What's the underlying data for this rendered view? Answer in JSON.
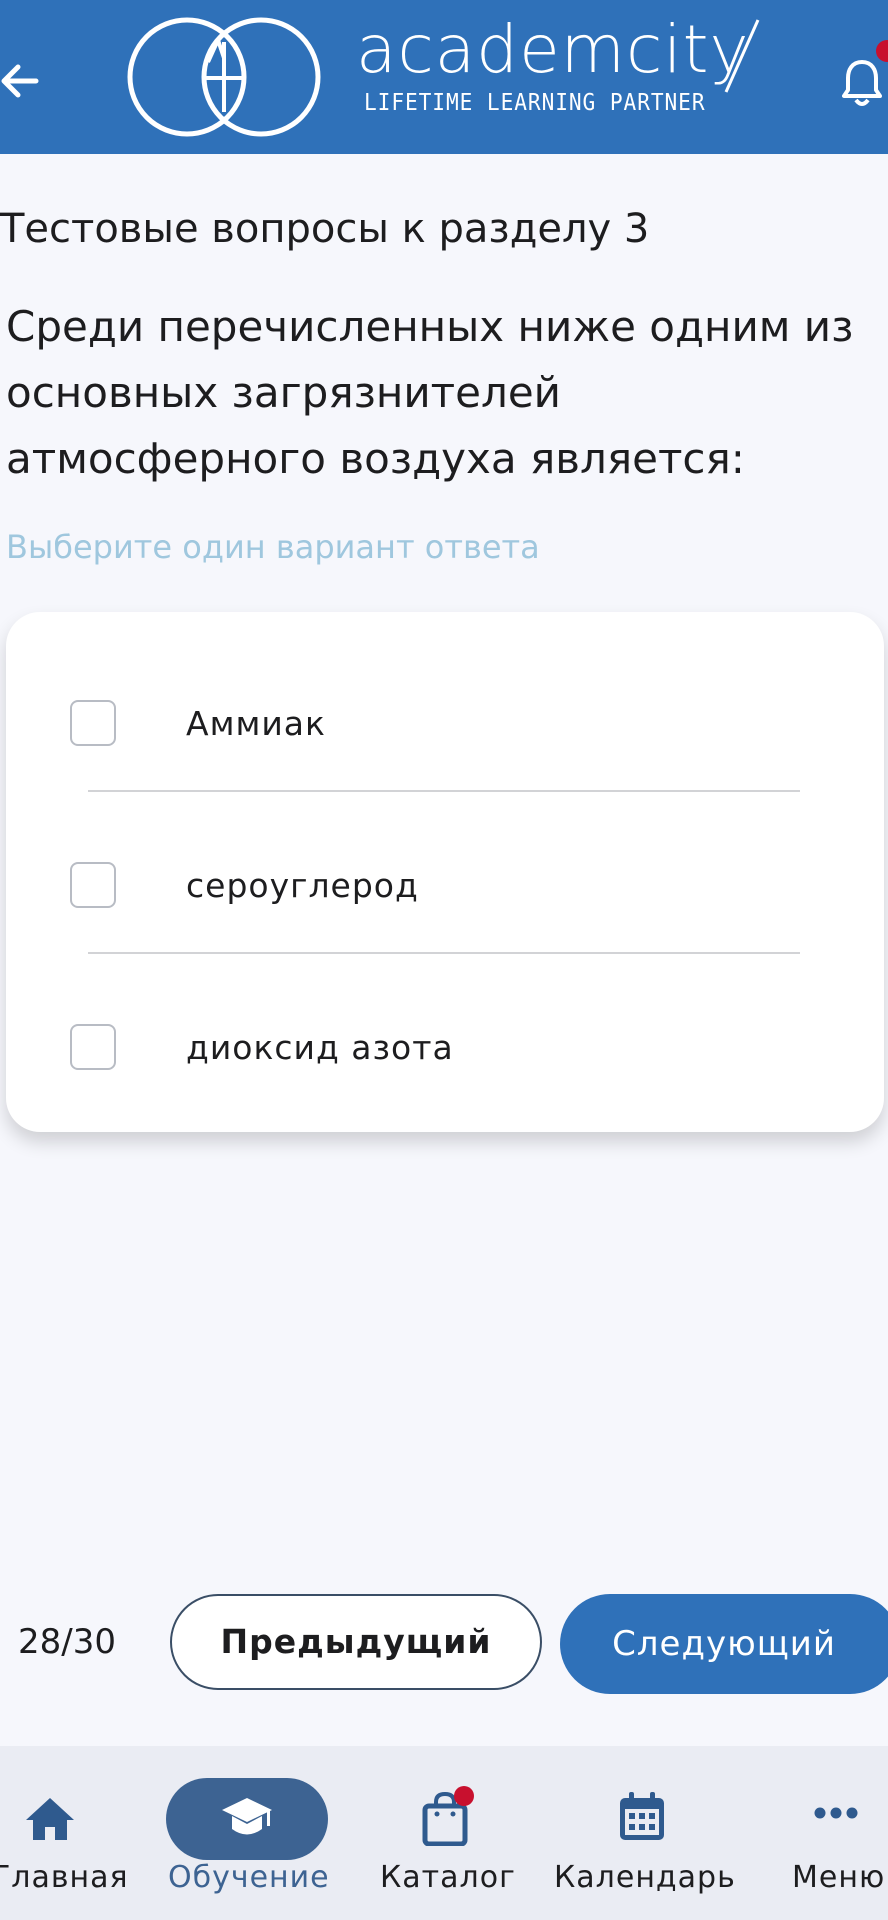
{
  "header": {
    "brand_name": "academcity",
    "brand_tagline": "LIFETIME LEARNING PARTNER"
  },
  "quiz": {
    "section_title": "Тестовые вопросы к разделу 3",
    "question": "Среди перечисленных ниже одним из основных загрязнителей атмосферного воздуха является:",
    "hint": "Выберите один вариант ответа",
    "options": [
      {
        "label": "Аммиак",
        "checked": false
      },
      {
        "label": "сероуглерод",
        "checked": false
      },
      {
        "label": "диоксид азота",
        "checked": false
      }
    ]
  },
  "pager": {
    "counter": "28/30",
    "prev_label": "Предыдущий",
    "next_label": "Следующий"
  },
  "bottom_nav": {
    "items": [
      {
        "label": "Главная",
        "icon": "home-icon"
      },
      {
        "label": "Обучение",
        "icon": "graduation-cap-icon",
        "active": true
      },
      {
        "label": "Каталог",
        "icon": "shopping-bag-icon"
      },
      {
        "label": "Календарь",
        "icon": "calendar-icon"
      },
      {
        "label": "Меню",
        "icon": "more-dots-icon"
      }
    ]
  },
  "colors": {
    "header_bg": "#2f71b9",
    "accent": "#2f71b9",
    "active_nav": "#3d6392",
    "badge": "#c8102e",
    "hint_text": "#9fc7de"
  }
}
